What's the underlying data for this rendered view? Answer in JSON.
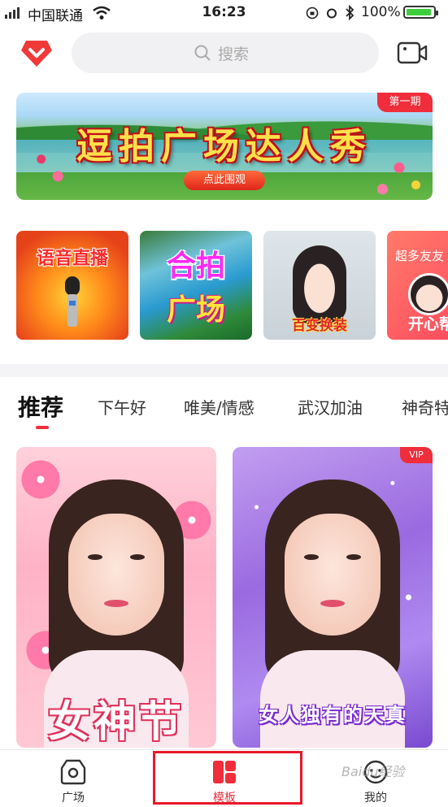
{
  "status_bar": {
    "carrier": "中国联通",
    "time": "16:23",
    "battery_percent": "100%"
  },
  "header": {
    "search_placeholder": "搜索"
  },
  "banner": {
    "title": "逗拍广场达人秀",
    "cta": "点此围观",
    "badge": "第一期"
  },
  "categories": [
    {
      "label": "语音直播"
    },
    {
      "label_line1": "合拍",
      "label_line2": "广场"
    },
    {
      "label": "百变换装"
    },
    {
      "label": "超多友友",
      "sub": "开心帮"
    }
  ],
  "tabs": [
    {
      "label": "推荐",
      "active": true
    },
    {
      "label": "下午好"
    },
    {
      "label": "唯美/情感"
    },
    {
      "label": "武汉加油"
    },
    {
      "label": "神奇特"
    }
  ],
  "templates": [
    {
      "caption": "女神节"
    },
    {
      "caption": "女人独有的天真",
      "badge": "VIP"
    }
  ],
  "bottom_nav": [
    {
      "label": "广场",
      "icon": "square-icon"
    },
    {
      "label": "模板",
      "icon": "template-icon",
      "active": true
    },
    {
      "label": "我的",
      "icon": "profile-icon"
    }
  ],
  "watermark": "Baidu经验",
  "colors": {
    "accent": "#f02d3a",
    "highlight_box": "#e8182a"
  }
}
